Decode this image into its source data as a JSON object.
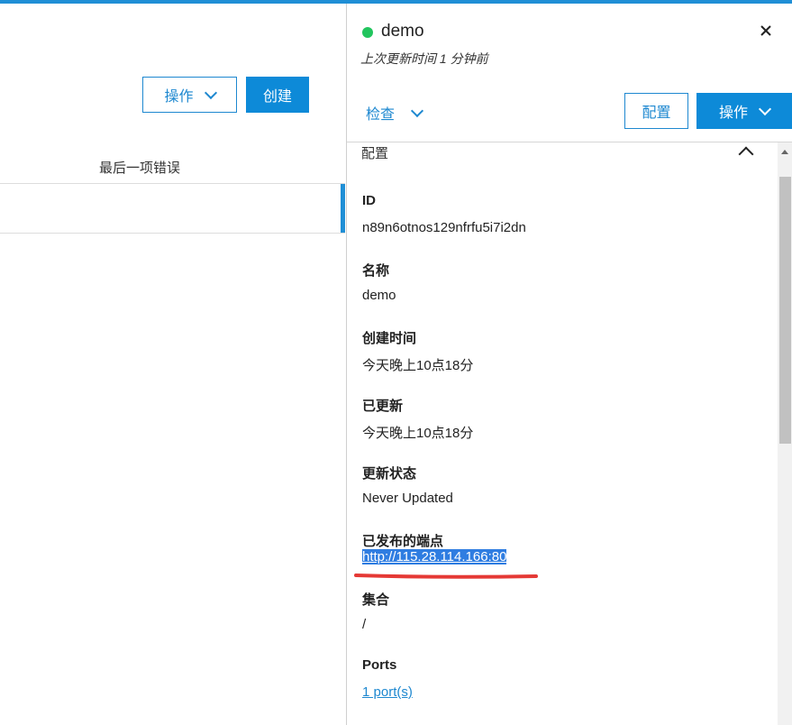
{
  "main": {
    "actions_label": "操作",
    "create_label": "创建",
    "column_header": "最后一项错误"
  },
  "detail": {
    "title": "demo",
    "status_color": "#22c55e",
    "updated_text": "上次更新时间 1 分钟前",
    "inspect_label": "检查",
    "configure_label": "配置",
    "actions_label": "操作",
    "section_title": "配置",
    "fields": [
      {
        "label": "ID",
        "value": "n89n6otnos129nfrfu5i7i2dn"
      },
      {
        "label": "名称",
        "value": "demo"
      },
      {
        "label": "创建时间",
        "value": "今天晚上10点18分"
      },
      {
        "label": "已更新",
        "value": "今天晚上10点18分"
      },
      {
        "label": "更新状态",
        "value": "Never Updated"
      },
      {
        "label": "已发布的端点",
        "value": "http://115.28.114.166:80"
      },
      {
        "label": "集合",
        "value": "/"
      },
      {
        "label": "Ports",
        "value": "1 port(s)"
      }
    ]
  },
  "colors": {
    "accent": "#1e88d0",
    "primary_button": "#0d8ad8",
    "annotation": "#e53935"
  }
}
